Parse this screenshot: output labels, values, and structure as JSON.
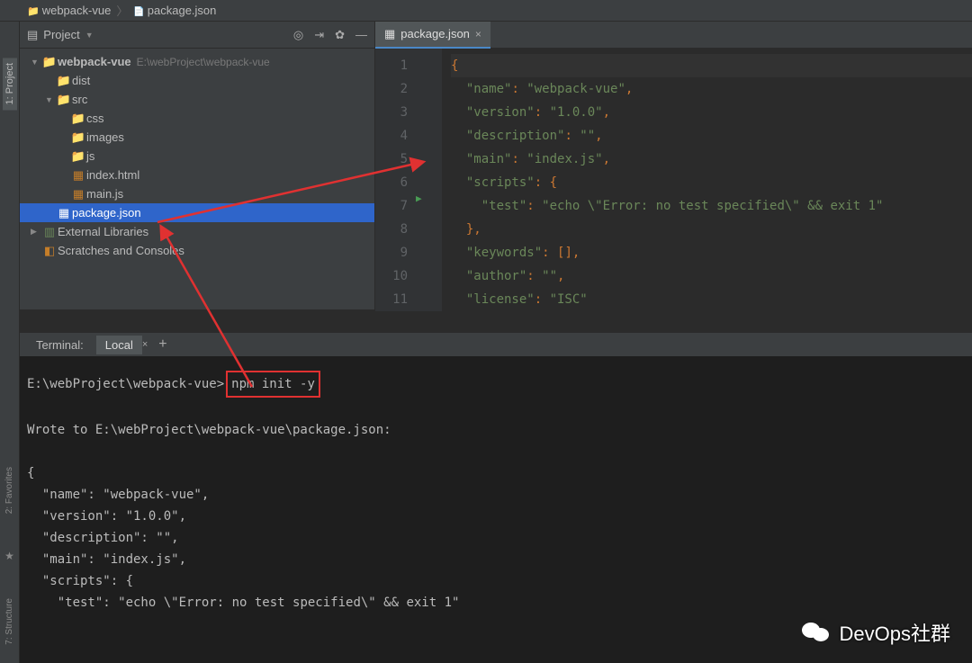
{
  "breadcrumb": {
    "project": "webpack-vue",
    "file": "package.json"
  },
  "project_panel": {
    "title": "Project",
    "root": {
      "name": "webpack-vue",
      "path": "E:\\webProject\\webpack-vue"
    },
    "tree": {
      "dist": "dist",
      "src": "src",
      "css": "css",
      "images": "images",
      "js": "js",
      "index_html": "index.html",
      "main_js": "main.js",
      "package_json": "package.json",
      "external": "External Libraries",
      "scratches": "Scratches and Consoles"
    }
  },
  "editor": {
    "tab": "package.json",
    "lines": [
      "{",
      "  \"name\": \"webpack-vue\",",
      "  \"version\": \"1.0.0\",",
      "  \"description\": \"\",",
      "  \"main\": \"index.js\",",
      "  \"scripts\": {",
      "    \"test\": \"echo \\\"Error: no test specified\\\" && exit 1\"",
      "  },",
      "  \"keywords\": [],",
      "  \"author\": \"\",",
      "  \"license\": \"ISC\""
    ],
    "line_numbers": [
      "1",
      "2",
      "3",
      "4",
      "5",
      "6",
      "7",
      "8",
      "9",
      "10",
      "11"
    ]
  },
  "terminal": {
    "tab_label": "Terminal:",
    "local_tab": "Local",
    "prompt": "E:\\webProject\\webpack-vue>",
    "command": "npm init -y",
    "output_header": "Wrote to E:\\webProject\\webpack-vue\\package.json:",
    "json_lines": [
      "{",
      "  \"name\": \"webpack-vue\",",
      "  \"version\": \"1.0.0\",",
      "  \"description\": \"\",",
      "  \"main\": \"index.js\",",
      "  \"scripts\": {",
      "    \"test\": \"echo \\\"Error: no test specified\\\" && exit 1\""
    ]
  },
  "side_tabs": {
    "project": "1: Project",
    "favorites": "2: Favorites",
    "structure": "7: Structure"
  },
  "watermark": "DevOps社群"
}
